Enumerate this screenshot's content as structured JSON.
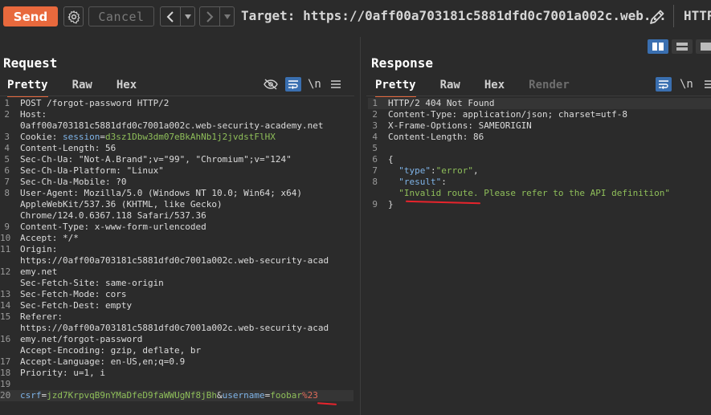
{
  "toolbar": {
    "send_label": "Send",
    "cancel_label": "Cancel",
    "target_text": "Target: https://0aff00a703181c5881dfd0c7001a002c.web...",
    "http_label": "HTTP"
  },
  "request": {
    "title": "Request",
    "tabs": [
      "Pretty",
      "Raw",
      "Hex"
    ],
    "newline_label": "\\n",
    "lines": [
      {
        "n": "1",
        "parts": [
          {
            "t": "POST /forgot-password HTTP/2",
            "c": "w"
          }
        ]
      },
      {
        "n": "2",
        "parts": [
          {
            "t": "Host:",
            "c": "w"
          }
        ]
      },
      {
        "n": "",
        "parts": [
          {
            "t": "0aff00a703181c5881dfd0c7001a002c.web-security-academy.net",
            "c": "w"
          }
        ]
      },
      {
        "n": "3",
        "parts": [
          {
            "t": "Cookie: ",
            "c": "w"
          },
          {
            "t": "session",
            "c": "b"
          },
          {
            "t": "=",
            "c": "w"
          },
          {
            "t": "d3sz1Dbw3dm07eBkAhNb1j2jvdstFlHX",
            "c": "g"
          }
        ]
      },
      {
        "n": "4",
        "parts": [
          {
            "t": "Content-Length: 56",
            "c": "w"
          }
        ]
      },
      {
        "n": "5",
        "parts": [
          {
            "t": "Sec-Ch-Ua: \"Not-A.Brand\";v=\"99\", \"Chromium\";v=\"124\"",
            "c": "w"
          }
        ]
      },
      {
        "n": "6",
        "parts": [
          {
            "t": "Sec-Ch-Ua-Platform: \"Linux\"",
            "c": "w"
          }
        ]
      },
      {
        "n": "7",
        "parts": [
          {
            "t": "Sec-Ch-Ua-Mobile: ?0",
            "c": "w"
          }
        ]
      },
      {
        "n": "8",
        "parts": [
          {
            "t": "User-Agent: Mozilla/5.0 (Windows NT 10.0; Win64; x64)",
            "c": "w"
          }
        ]
      },
      {
        "n": "",
        "parts": [
          {
            "t": "AppleWebKit/537.36 (KHTML, like Gecko)",
            "c": "w"
          }
        ]
      },
      {
        "n": "",
        "parts": [
          {
            "t": "Chrome/124.0.6367.118 Safari/537.36",
            "c": "w"
          }
        ]
      },
      {
        "n": "9",
        "parts": [
          {
            "t": "Content-Type: x-www-form-urlencoded",
            "c": "w"
          }
        ]
      },
      {
        "n": "10",
        "parts": [
          {
            "t": "Accept: */*",
            "c": "w"
          }
        ]
      },
      {
        "n": "11",
        "parts": [
          {
            "t": "Origin:",
            "c": "w"
          }
        ]
      },
      {
        "n": "",
        "parts": [
          {
            "t": "https://0aff00a703181c5881dfd0c7001a002c.web-security-acad",
            "c": "w"
          }
        ]
      },
      {
        "n": "12",
        "parts": [
          {
            "t": "emy.net",
            "c": "w"
          }
        ]
      },
      {
        "n": "",
        "parts": [
          {
            "t": "Sec-Fetch-Site: same-origin",
            "c": "w"
          }
        ]
      },
      {
        "n": "13",
        "parts": [
          {
            "t": "Sec-Fetch-Mode: cors",
            "c": "w"
          }
        ]
      },
      {
        "n": "14",
        "parts": [
          {
            "t": "Sec-Fetch-Dest: empty",
            "c": "w"
          }
        ]
      },
      {
        "n": "15",
        "parts": [
          {
            "t": "Referer:",
            "c": "w"
          }
        ]
      },
      {
        "n": "",
        "parts": [
          {
            "t": "https://0aff00a703181c5881dfd0c7001a002c.web-security-acad",
            "c": "w"
          }
        ]
      },
      {
        "n": "16",
        "parts": [
          {
            "t": "emy.net/forgot-password",
            "c": "w"
          }
        ]
      },
      {
        "n": "",
        "parts": [
          {
            "t": "Accept-Encoding: gzip, deflate, br",
            "c": "w"
          }
        ]
      },
      {
        "n": "17",
        "parts": [
          {
            "t": "Accept-Language: en-US,en;q=0.9",
            "c": "w"
          }
        ]
      },
      {
        "n": "18",
        "parts": [
          {
            "t": "Priority: u=1, i",
            "c": "w"
          }
        ]
      },
      {
        "n": "19",
        "parts": [
          {
            "t": "",
            "c": "w"
          }
        ]
      },
      {
        "n": "20",
        "parts": [
          {
            "t": "csrf",
            "c": "b"
          },
          {
            "t": "=",
            "c": "w"
          },
          {
            "t": "jzd7KrpvqB9nYMaDfeD9faWWUgNf8jBh",
            "c": "g"
          },
          {
            "t": "&",
            "c": "w"
          },
          {
            "t": "username",
            "c": "b"
          },
          {
            "t": "=",
            "c": "w"
          },
          {
            "t": "foobar",
            "c": "g"
          },
          {
            "t": "%23",
            "c": "r"
          }
        ],
        "hl": true
      }
    ]
  },
  "response": {
    "title": "Response",
    "tabs": [
      "Pretty",
      "Raw",
      "Hex",
      "Render"
    ],
    "newline_label": "\\n",
    "lines": [
      {
        "n": "1",
        "parts": [
          {
            "t": "HTTP/2 404 Not Found",
            "c": "w"
          }
        ],
        "hl": true
      },
      {
        "n": "2",
        "parts": [
          {
            "t": "Content-Type: application/json; charset=utf-8",
            "c": "w"
          }
        ]
      },
      {
        "n": "3",
        "parts": [
          {
            "t": "X-Frame-Options: SAMEORIGIN",
            "c": "w"
          }
        ]
      },
      {
        "n": "4",
        "parts": [
          {
            "t": "Content-Length: 86",
            "c": "w"
          }
        ]
      },
      {
        "n": "5",
        "parts": [
          {
            "t": "",
            "c": "w"
          }
        ]
      },
      {
        "n": "6",
        "parts": [
          {
            "t": "{",
            "c": "w"
          }
        ]
      },
      {
        "n": "7",
        "parts": [
          {
            "t": "  \"type\"",
            "c": "b"
          },
          {
            "t": ":",
            "c": "w"
          },
          {
            "t": "\"error\"",
            "c": "g"
          },
          {
            "t": ",",
            "c": "w"
          }
        ]
      },
      {
        "n": "8",
        "parts": [
          {
            "t": "  \"result\"",
            "c": "b"
          },
          {
            "t": ":",
            "c": "w"
          }
        ]
      },
      {
        "n": "",
        "parts": [
          {
            "t": "  \"Invalid route. Please refer to the API definition\"",
            "c": "g"
          }
        ]
      },
      {
        "n": "9",
        "parts": [
          {
            "t": "}",
            "c": "w"
          }
        ]
      }
    ]
  },
  "colors": {
    "accent": "#e8693d",
    "active_blue": "#3a6fb0",
    "string_green": "#8fbf5a",
    "key_blue": "#7fb4e8",
    "annotation_red": "#e8242c"
  }
}
